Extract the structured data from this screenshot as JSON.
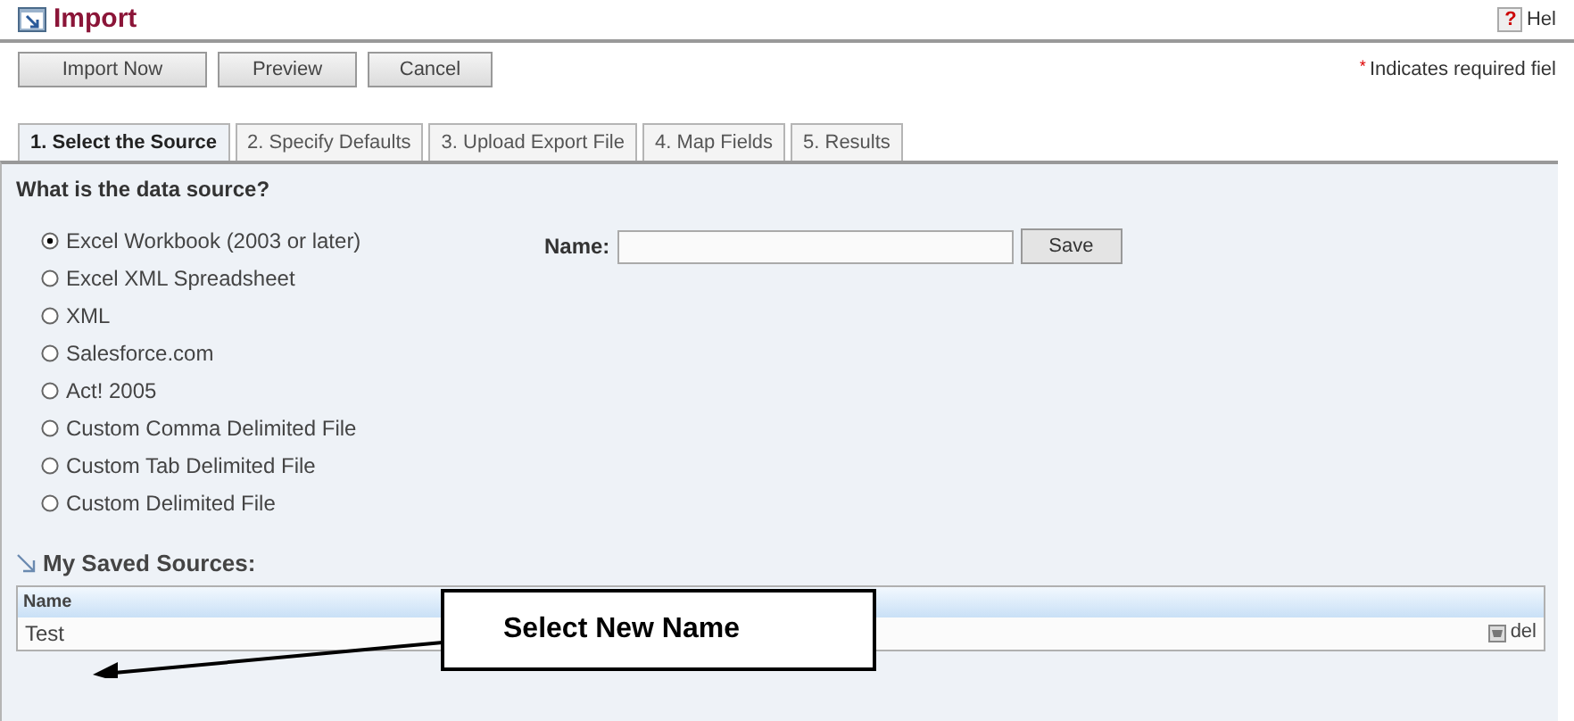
{
  "header": {
    "title": "Import",
    "help_icon": "?",
    "help": "Hel"
  },
  "toolbar": {
    "buttons": [
      "Import Now",
      "Preview",
      "Cancel"
    ],
    "required_mark": "*",
    "required_note": "Indicates required fiel"
  },
  "tabs": [
    {
      "label": "1. Select the Source",
      "selected": true
    },
    {
      "label": "2. Specify Defaults",
      "selected": false
    },
    {
      "label": "3. Upload Export File",
      "selected": false
    },
    {
      "label": "4. Map Fields",
      "selected": false
    },
    {
      "label": "5. Results",
      "selected": false
    }
  ],
  "source": {
    "question": "What is the data source?",
    "options": [
      {
        "label": "Excel Workbook (2003 or later)",
        "selected": true
      },
      {
        "label": "Excel XML Spreadsheet",
        "selected": false
      },
      {
        "label": "XML",
        "selected": false
      },
      {
        "label": "Salesforce.com",
        "selected": false
      },
      {
        "label": "Act! 2005",
        "selected": false
      },
      {
        "label": "Custom Comma Delimited File",
        "selected": false
      },
      {
        "label": "Custom Tab Delimited File",
        "selected": false
      },
      {
        "label": "Custom Delimited File",
        "selected": false
      }
    ]
  },
  "name_field": {
    "label": "Name:",
    "button": "Save"
  },
  "saved_sources": {
    "heading": "My Saved Sources:",
    "columns": [
      "Name"
    ],
    "rows": [
      {
        "name": "Test",
        "action": "del"
      }
    ]
  },
  "callout": {
    "text": "Select New Name"
  }
}
